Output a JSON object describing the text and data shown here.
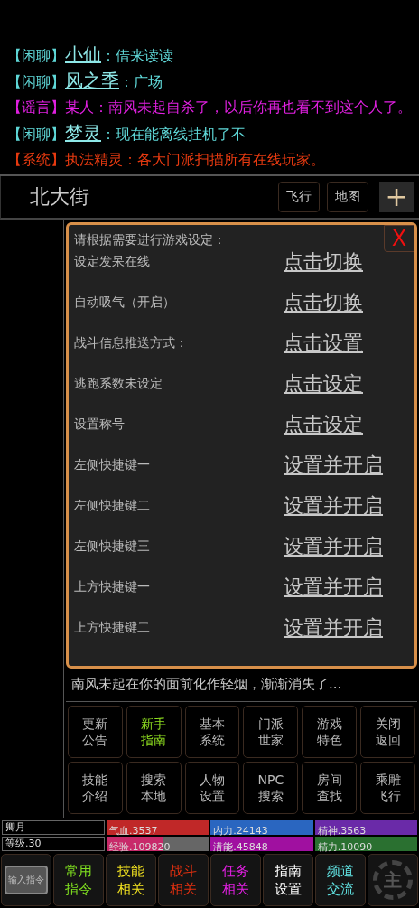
{
  "chat": [
    {
      "channel": "【闲聊】",
      "speaker": "小仙",
      "speaker_link": true,
      "text": "：借来读读",
      "color": "#5fd8d8"
    },
    {
      "channel": "【闲聊】",
      "speaker": "风之季",
      "speaker_link": true,
      "text": "：广场",
      "color": "#5fd8d8"
    },
    {
      "channel": "【谣言】",
      "speaker": "某人",
      "speaker_link": false,
      "text": "：南风未起自杀了，以后你再也看不到这个人了。",
      "color": "#e020e0"
    },
    {
      "channel": "【闲聊】",
      "speaker": "梦灵",
      "speaker_link": true,
      "text": "：现在能离线挂机了不",
      "color": "#5fd8d8"
    },
    {
      "channel": "【系统】",
      "speaker": "执法精灵",
      "speaker_link": false,
      "text": "：各大门派扫描所有在线玩家。",
      "color": "#e83a10"
    }
  ],
  "location": {
    "name": "北大街",
    "buttons": [
      "飞行",
      "地图"
    ],
    "add": "+"
  },
  "dialog": {
    "title": "请根据需要进行游戏设定：",
    "close": "X",
    "rows": [
      {
        "label": "设定发呆在线",
        "action": "点击切换"
      },
      {
        "label": "自动吸气（开启）",
        "action": "点击切换"
      },
      {
        "label": "战斗信息推送方式：",
        "action": "点击设置"
      },
      {
        "label": "逃跑系数未设定",
        "action": "点击设定"
      },
      {
        "label": "设置称号",
        "action": "点击设定"
      },
      {
        "label": "左侧快捷键一",
        "action": "设置并开启"
      },
      {
        "label": "左侧快捷键二",
        "action": "设置并开启"
      },
      {
        "label": "左侧快捷键三",
        "action": "设置并开启"
      },
      {
        "label": "上方快捷键一",
        "action": "设置并开启"
      },
      {
        "label": "上方快捷键二",
        "action": "设置并开启"
      }
    ]
  },
  "message": "南风未起在你的面前化作轻烟，渐渐消失了...",
  "menu": [
    {
      "label": "更新公告",
      "selected": false
    },
    {
      "label": "新手指南",
      "selected": true
    },
    {
      "label": "基本系统",
      "selected": false
    },
    {
      "label": "门派世家",
      "selected": false
    },
    {
      "label": "游戏特色",
      "selected": false
    },
    {
      "label": "关闭返回",
      "selected": false
    },
    {
      "label": "技能介绍",
      "selected": false
    },
    {
      "label": "搜索本地",
      "selected": false
    },
    {
      "label": "人物设置",
      "selected": false
    },
    {
      "label": "NPC搜索",
      "selected": false
    },
    {
      "label": "房间查找",
      "selected": false
    },
    {
      "label": "乘雕飞行",
      "selected": false
    }
  ],
  "stats": {
    "name": "卿月",
    "level_text": "等级.30",
    "bars": [
      {
        "label": "气血.3537",
        "level": 1,
        "color": "#c02828"
      },
      {
        "label": "内力.24143",
        "level": 1,
        "color": "#2a66c0"
      },
      {
        "label": "精神.3563",
        "level": 1,
        "color": "#6a2aa8"
      },
      {
        "label": "经验.109820",
        "level": 0.55,
        "color": "#c82a6a"
      },
      {
        "label": "潜能.45848",
        "level": 1,
        "color": "#a010a0"
      },
      {
        "label": "精力.10090",
        "level": 1,
        "color": "#2a7030"
      }
    ]
  },
  "toolbar": [
    {
      "kind": "input",
      "label": "输入指令"
    },
    {
      "kind": "text",
      "label": "常用指令",
      "color": "#80e020"
    },
    {
      "kind": "text",
      "label": "技能相关",
      "color": "#f0e020"
    },
    {
      "kind": "text",
      "label": "战斗相关",
      "color": "#e03010"
    },
    {
      "kind": "text",
      "label": "任务相关",
      "color": "#e020e0"
    },
    {
      "kind": "text",
      "label": "指南设置",
      "color": "#ffffff"
    },
    {
      "kind": "text",
      "label": "频道交流",
      "color": "#60e0e0"
    },
    {
      "kind": "gear",
      "label": "主"
    }
  ]
}
